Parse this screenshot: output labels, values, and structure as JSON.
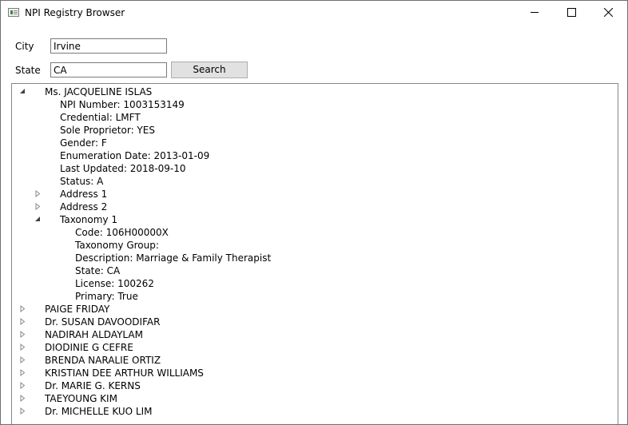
{
  "window": {
    "title": "NPI Registry Browser"
  },
  "form": {
    "city_label": "City",
    "city_value": "Irvine",
    "state_label": "State",
    "state_value": "CA",
    "search_label": "Search"
  },
  "tree": {
    "provider": {
      "name": "Ms. JACQUELINE ISLAS",
      "details": [
        "NPI Number: 1003153149",
        "Credential: LMFT",
        "Sole Proprietor: YES",
        "Gender: F",
        "Enumeration Date: 2013-01-09",
        "Last Updated: 2018-09-10",
        "Status: A"
      ],
      "address1": "Address 1",
      "address2": "Address 2",
      "taxonomy": "Taxonomy 1",
      "taxonomy_details": [
        "Code: 106H00000X",
        "Taxonomy Group:",
        "Description: Marriage & Family Therapist",
        "State: CA",
        "License: 100262",
        "Primary: True"
      ]
    },
    "others": [
      "PAIGE FRIDAY",
      "Dr. SUSAN DAVOODIFAR",
      "NADIRAH ALDAYLAM",
      "DIODINIE G CEFRE",
      "BRENDA NARALIE ORTIZ",
      "KRISTIAN DEE ARTHUR WILLIAMS",
      "Dr. MARIE G. KERNS",
      "TAEYOUNG KIM",
      "Dr. MICHELLE KUO LIM"
    ]
  }
}
